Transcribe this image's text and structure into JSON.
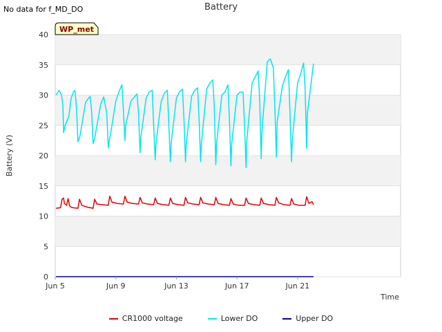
{
  "page_note": "No data for f_MD_DO",
  "chart_data": {
    "type": "line",
    "title": "Battery",
    "xlabel": "Time",
    "ylabel": "Battery (V)",
    "badge": "WP_met",
    "xlim": [
      0,
      22.8
    ],
    "ylim": [
      0,
      40
    ],
    "yticks": [
      0,
      5,
      10,
      15,
      20,
      25,
      30,
      35,
      40
    ],
    "xticks": [
      {
        "value": 0.0,
        "label": "Jun 5"
      },
      {
        "value": 4.0,
        "label": "Jun 9"
      },
      {
        "value": 8.0,
        "label": "Jun 13"
      },
      {
        "value": 12.0,
        "label": "Jun 17"
      },
      {
        "value": 16.0,
        "label": "Jun 21"
      }
    ],
    "grid": true,
    "legend_position": "bottom",
    "series": [
      {
        "name": "CR1000 voltage",
        "color": "#e00000",
        "x": [
          0.05,
          0.35,
          0.45,
          0.55,
          0.6,
          0.75,
          0.85,
          0.95,
          1.05,
          1.15,
          1.5,
          1.6,
          1.75,
          2.1,
          2.5,
          2.6,
          2.75,
          3.1,
          3.5,
          3.6,
          3.75,
          4.1,
          4.5,
          4.6,
          4.75,
          5.1,
          5.5,
          5.6,
          5.75,
          6.1,
          6.5,
          6.6,
          6.75,
          7.1,
          7.5,
          7.6,
          7.75,
          8.1,
          8.5,
          8.6,
          8.75,
          9.1,
          9.5,
          9.6,
          9.75,
          10.1,
          10.5,
          10.6,
          10.75,
          11.1,
          11.5,
          11.6,
          11.75,
          12.1,
          12.5,
          12.6,
          12.75,
          13.1,
          13.5,
          13.6,
          13.75,
          14.1,
          14.5,
          14.6,
          14.75,
          15.1,
          15.5,
          15.6,
          15.75,
          16.1,
          16.5,
          16.6,
          16.75,
          16.95,
          17.05
        ],
        "values": [
          11.3,
          11.4,
          12.8,
          13.0,
          12.1,
          11.8,
          12.9,
          11.7,
          11.5,
          11.4,
          11.3,
          12.8,
          11.8,
          11.5,
          11.3,
          12.8,
          12.0,
          11.9,
          11.8,
          13.3,
          12.3,
          12.1,
          12.0,
          13.3,
          12.3,
          12.1,
          12.0,
          13.1,
          12.2,
          12.0,
          11.9,
          13.0,
          12.1,
          11.9,
          11.8,
          13.0,
          12.1,
          11.9,
          11.8,
          13.1,
          12.2,
          12.0,
          11.9,
          13.1,
          12.2,
          12.0,
          11.9,
          13.1,
          12.1,
          11.9,
          11.8,
          12.9,
          12.0,
          11.8,
          11.8,
          13.0,
          12.1,
          11.9,
          11.8,
          13.0,
          12.1,
          11.9,
          11.8,
          13.1,
          12.2,
          11.9,
          11.8,
          12.9,
          12.0,
          11.8,
          11.8,
          13.2,
          12.1,
          12.4,
          11.9
        ]
      },
      {
        "name": "Lower DO",
        "color": "#00e5ee",
        "x": [
          0.05,
          0.25,
          0.4,
          0.5,
          0.55,
          0.65,
          0.9,
          1.05,
          1.2,
          1.3,
          1.4,
          1.5,
          1.6,
          1.65,
          2.0,
          2.2,
          2.3,
          2.4,
          2.5,
          2.6,
          2.65,
          3.0,
          3.2,
          3.4,
          3.5,
          3.6,
          3.65,
          4.0,
          4.2,
          4.4,
          4.5,
          4.6,
          4.65,
          5.0,
          5.2,
          5.4,
          5.5,
          5.6,
          5.65,
          6.0,
          6.2,
          6.4,
          6.5,
          6.6,
          6.65,
          7.0,
          7.2,
          7.4,
          7.5,
          7.6,
          7.65,
          8.0,
          8.2,
          8.4,
          8.5,
          8.6,
          8.65,
          9.0,
          9.2,
          9.4,
          9.5,
          9.6,
          9.65,
          10.0,
          10.2,
          10.4,
          10.5,
          10.6,
          10.65,
          11.0,
          11.2,
          11.4,
          11.5,
          11.6,
          11.65,
          12.0,
          12.2,
          12.4,
          12.5,
          12.6,
          12.65,
          13.0,
          13.2,
          13.4,
          13.5,
          13.6,
          13.65,
          14.0,
          14.2,
          14.4,
          14.5,
          14.6,
          14.65,
          15.0,
          15.2,
          15.4,
          15.5,
          15.6,
          15.65,
          16.0,
          16.2,
          16.4,
          16.5,
          16.6,
          16.65,
          17.05
        ],
        "values": [
          30.0,
          30.8,
          30.1,
          28.5,
          23.8,
          25.0,
          26.5,
          29.5,
          30.5,
          30.8,
          28.0,
          22.3,
          23.0,
          23.5,
          28.8,
          29.5,
          29.8,
          27.5,
          22.0,
          22.8,
          23.5,
          28.5,
          29.7,
          27.0,
          21.3,
          23.0,
          23.5,
          29.0,
          30.5,
          31.7,
          27.5,
          22.5,
          25.0,
          29.0,
          29.6,
          30.2,
          27.0,
          20.5,
          23.0,
          29.5,
          30.5,
          30.8,
          25.0,
          19.3,
          22.0,
          29.0,
          30.3,
          30.8,
          25.0,
          19.0,
          22.0,
          29.5,
          30.5,
          31.0,
          26.0,
          19.0,
          22.0,
          29.8,
          30.8,
          31.2,
          26.0,
          19.0,
          22.0,
          31.0,
          32.0,
          32.5,
          28.0,
          18.5,
          22.0,
          30.0,
          30.5,
          31.7,
          26.0,
          18.3,
          22.0,
          30.0,
          30.5,
          30.5,
          25.0,
          18.0,
          22.5,
          32.0,
          33.0,
          34.0,
          29.0,
          19.5,
          24.0,
          35.5,
          36.0,
          34.5,
          28.0,
          19.8,
          25.5,
          31.5,
          33.0,
          34.2,
          27.0,
          19.0,
          22.5,
          32.0,
          33.5,
          35.3,
          31.0,
          21.2,
          27.0,
          35.2
        ]
      },
      {
        "name": "Upper DO",
        "color": "#0000aa",
        "x": [
          0.05,
          17.05
        ],
        "values": [
          0.0,
          0.0
        ]
      }
    ]
  }
}
